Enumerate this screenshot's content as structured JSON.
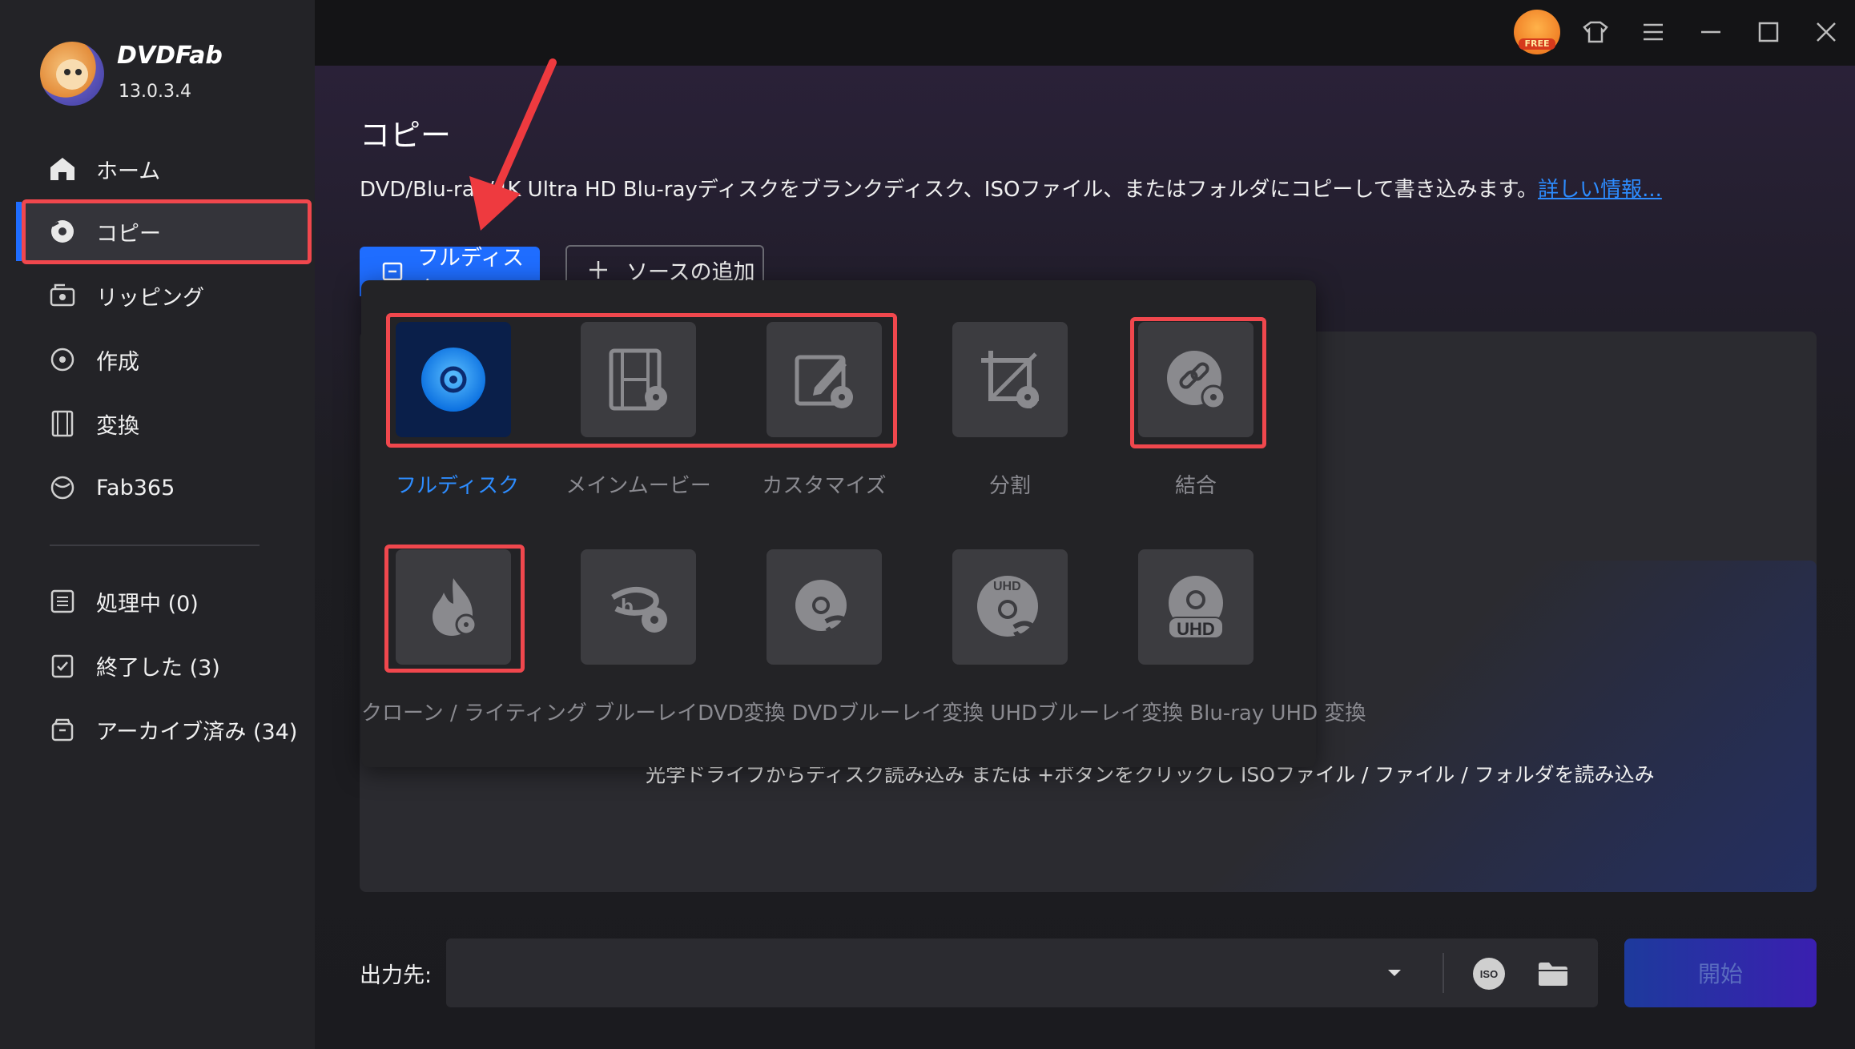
{
  "app": {
    "brand": "DVDFab",
    "version": "13.0.3.4"
  },
  "sidebar": {
    "items": [
      {
        "label": "ホーム"
      },
      {
        "label": "コピー"
      },
      {
        "label": "リッピング"
      },
      {
        "label": "作成"
      },
      {
        "label": "変換"
      },
      {
        "label": "Fab365"
      }
    ],
    "queue": [
      {
        "label": "処理中 (0)"
      },
      {
        "label": "終了した (3)"
      },
      {
        "label": "アーカイブ済み (34)"
      }
    ]
  },
  "topbar": {
    "free_badge": "FREE"
  },
  "main": {
    "title": "コピー",
    "description": "DVD/Blu-ray/4K Ultra HD Blu-rayディスクをブランクディスク、ISOファイル、またはフォルダにコピーして書き込みます。",
    "more_link": "詳しい情報...",
    "mode_button": "フルディスク",
    "add_source": "ソースの追加",
    "drop_hint": "光学ドライブからディスク読み込み または +ボタンをクリックし ISOファイル / ファイル / フォルダを読み込み",
    "modes_row1": [
      {
        "label": "フルディスク",
        "icon": "disc-icon"
      },
      {
        "label": "メインムービー",
        "icon": "film-icon"
      },
      {
        "label": "カスタマイズ",
        "icon": "edit-icon"
      },
      {
        "label": "分割",
        "icon": "split-icon"
      },
      {
        "label": "結合",
        "icon": "merge-icon"
      }
    ],
    "modes_row2_text": "クローン / ライティング ブルーレイDVD変換 DVDブルーレイ変換 UHDブルーレイ変換 Blu-ray UHD 変換",
    "modes_row2_icons": [
      "clone-burn-icon",
      "bluray-to-dvd-icon",
      "dvd-to-bluray-icon",
      "uhd-to-bluray-icon",
      "bluray-to-uhd-icon"
    ],
    "uhd_text": "UHD"
  },
  "output": {
    "label": "出力先:",
    "iso_text": "ISO",
    "start_button": "開始"
  },
  "colors": {
    "accent": "#1f6dff",
    "highlight": "#f0474d",
    "link": "#2d8cff"
  }
}
